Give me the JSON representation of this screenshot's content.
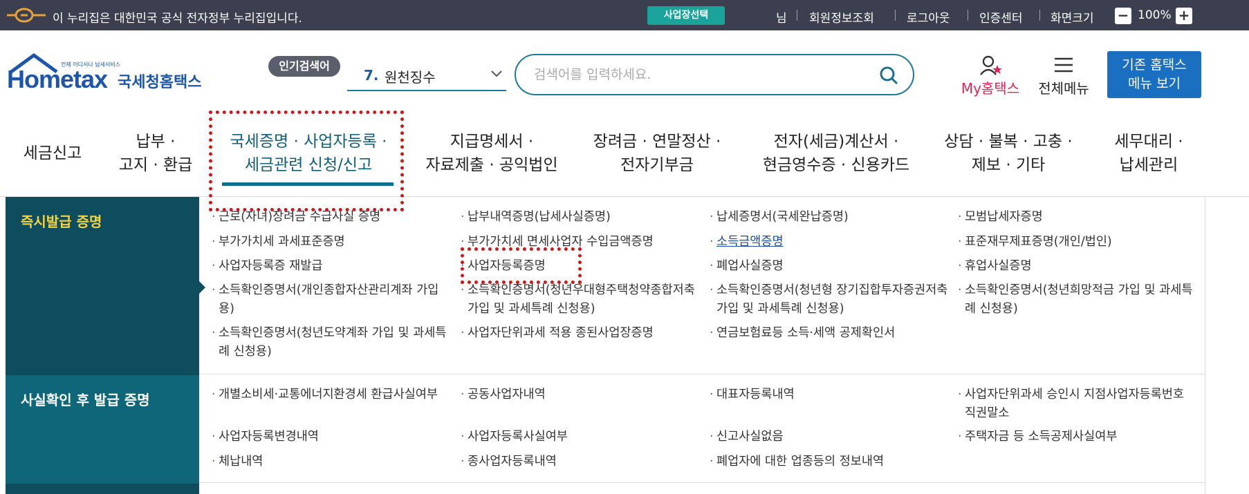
{
  "govbar": {
    "notice": "이 누리집은 대한민국 공식 전자정부 누리집입니다.",
    "biz_select": "사업장선택",
    "user_suffix": "님",
    "member_info": "회원정보조회",
    "logout": "로그아웃",
    "cert_center": "인증센터",
    "screen_size": "화면크기",
    "zoom_out": "−",
    "zoom_level": "100%",
    "zoom_in": "+"
  },
  "header": {
    "logo_small": "언제 어디서나 납세서비스",
    "logo_main": "Hometax",
    "logo_kr": "국세청홈택스",
    "popular_badge": "인기검색어",
    "popular_rank": "7.",
    "popular_term": "원천징수",
    "search_placeholder": "검색어를 입력하세요.",
    "my_hometax": "My홈택스",
    "all_menu": "전체메뉴",
    "old_menu_line1": "기존 홈택스",
    "old_menu_line2": "메뉴 보기"
  },
  "nav": [
    {
      "line1": "세금신고",
      "line2": ""
    },
    {
      "line1": "납부 ·",
      "line2": "고지 · 환급"
    },
    {
      "line1": "국세증명 · 사업자등록 ·",
      "line2": "세금관련 신청/신고"
    },
    {
      "line1": "지급명세서 ·",
      "line2": "자료제출 · 공익법인"
    },
    {
      "line1": "장려금 · 연말정산 ·",
      "line2": "전자기부금"
    },
    {
      "line1": "전자(세금)계산서 ·",
      "line2": "현금영수증 · 신용카드"
    },
    {
      "line1": "상담 · 불복 · 고충 ·",
      "line2": "제보 · 기타"
    },
    {
      "line1": "세무대리 ·",
      "line2": "납세관리"
    }
  ],
  "categories": [
    {
      "title": "즉시발급 증명"
    },
    {
      "title": "사실확인 후 발급 증명"
    }
  ],
  "instant_items": [
    {
      "text": "근로(자녀)장려금 수급사실 증명"
    },
    {
      "text": "납부내역증명(납세사실증명)"
    },
    {
      "text": "납세증명서(국세완납증명)"
    },
    {
      "text": "모범납세자증명"
    },
    {
      "text": "부가가치세 과세표준증명"
    },
    {
      "text": "부가가치세 면세사업자 수입금액증명"
    },
    {
      "text": "소득금액증명"
    },
    {
      "text": "표준재무제표증명(개인/법인)"
    },
    {
      "text": "사업자등록증 재발급"
    },
    {
      "text": "사업자등록증명"
    },
    {
      "text": "폐업사실증명"
    },
    {
      "text": "휴업사실증명"
    },
    {
      "text": "소득확인증명서(개인종합자산관리계좌 가입용)"
    },
    {
      "text": "소득확인증명서(청년우대형주택청약종합저축 가입 및 과세특례 신청용)"
    },
    {
      "text": "소득확인증명서(청년형 장기집합투자증권저축 가입 및 과세특례 신청용)"
    },
    {
      "text": "소득확인증명서(청년희망적금 가입 및 과세특례 신청용)"
    },
    {
      "text": "소득확인증명서(청년도약계좌 가입 및 과세특례 신청용)"
    },
    {
      "text": "사업자단위과세 적용 종된사업장증명"
    },
    {
      "text": "연금보험료등 소득·세액 공제확인서"
    }
  ],
  "verify_items": [
    {
      "text": "개별소비세·교통에너지환경세 환급사실여부"
    },
    {
      "text": "공동사업자내역"
    },
    {
      "text": "대표자등록내역"
    },
    {
      "text": "사업자단위과세 승인시 지점사업자등록번호 직권말소"
    },
    {
      "text": "사업자등록변경내역"
    },
    {
      "text": "사업자등록사실여부"
    },
    {
      "text": "신고사실없음"
    },
    {
      "text": "주택자금 등 소득공제사실여부"
    },
    {
      "text": "체납내역"
    },
    {
      "text": "종사업자등록내역"
    },
    {
      "text": "폐업자에 대한 업종등의 정보내역"
    }
  ],
  "colors": {
    "govbar_bg": "#3b3f50",
    "accent_teal": "#1aa39a",
    "brand_blue": "#1d56a8",
    "old_btn_blue": "#1a6fc0",
    "cat_dark": "#0e4d5e",
    "cat_teal": "#0f6679",
    "highlight_red": "#cc1a1a",
    "my_pink": "#e02454"
  }
}
